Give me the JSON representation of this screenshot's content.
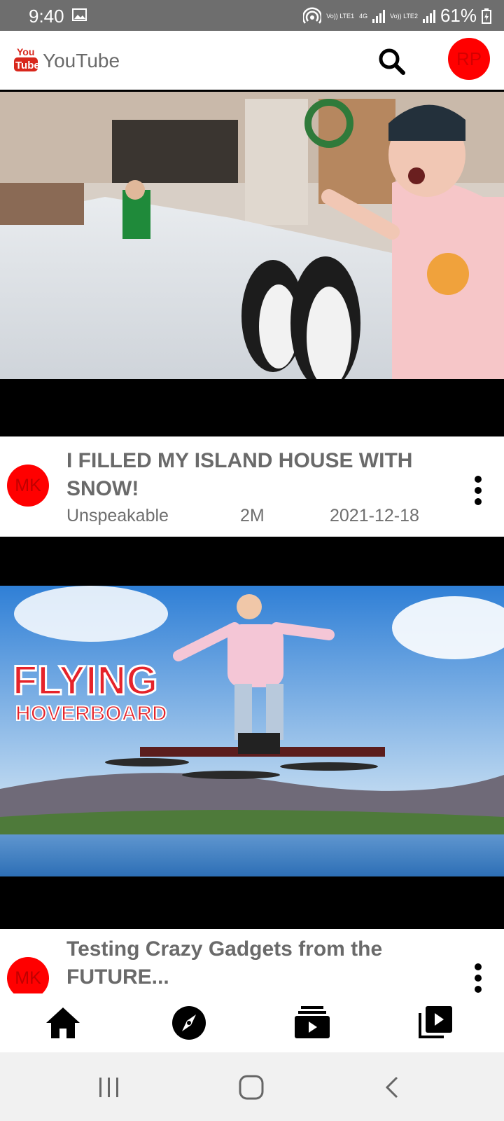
{
  "status_bar": {
    "time": "9:40",
    "net1": "Vo)) LTE1",
    "net_4g": "4G",
    "net2": "Vo)) LTE2",
    "battery": "61%"
  },
  "app_bar": {
    "logo_text_top": "You",
    "logo_text_bottom": "Tube",
    "title": "YouTube",
    "avatar_initials": "RP"
  },
  "videos": [
    {
      "title": "I FILLED MY ISLAND HOUSE WITH SNOW!",
      "channel": "Unspeakable",
      "views": "2M",
      "date": "2021-12-18",
      "avatar_initials": "MK"
    },
    {
      "title": "Testing Crazy Gadgets from the FUTURE...",
      "thumbnail_text_1": "FLYING",
      "thumbnail_text_2": "HOVERBOARD",
      "avatar_initials": "MK"
    }
  ],
  "bottom_nav": [
    "home-icon",
    "explore-icon",
    "subscriptions-icon",
    "library-icon"
  ],
  "colors": {
    "brand_red": "#ff0000",
    "title_gray": "#6a6a6a"
  }
}
